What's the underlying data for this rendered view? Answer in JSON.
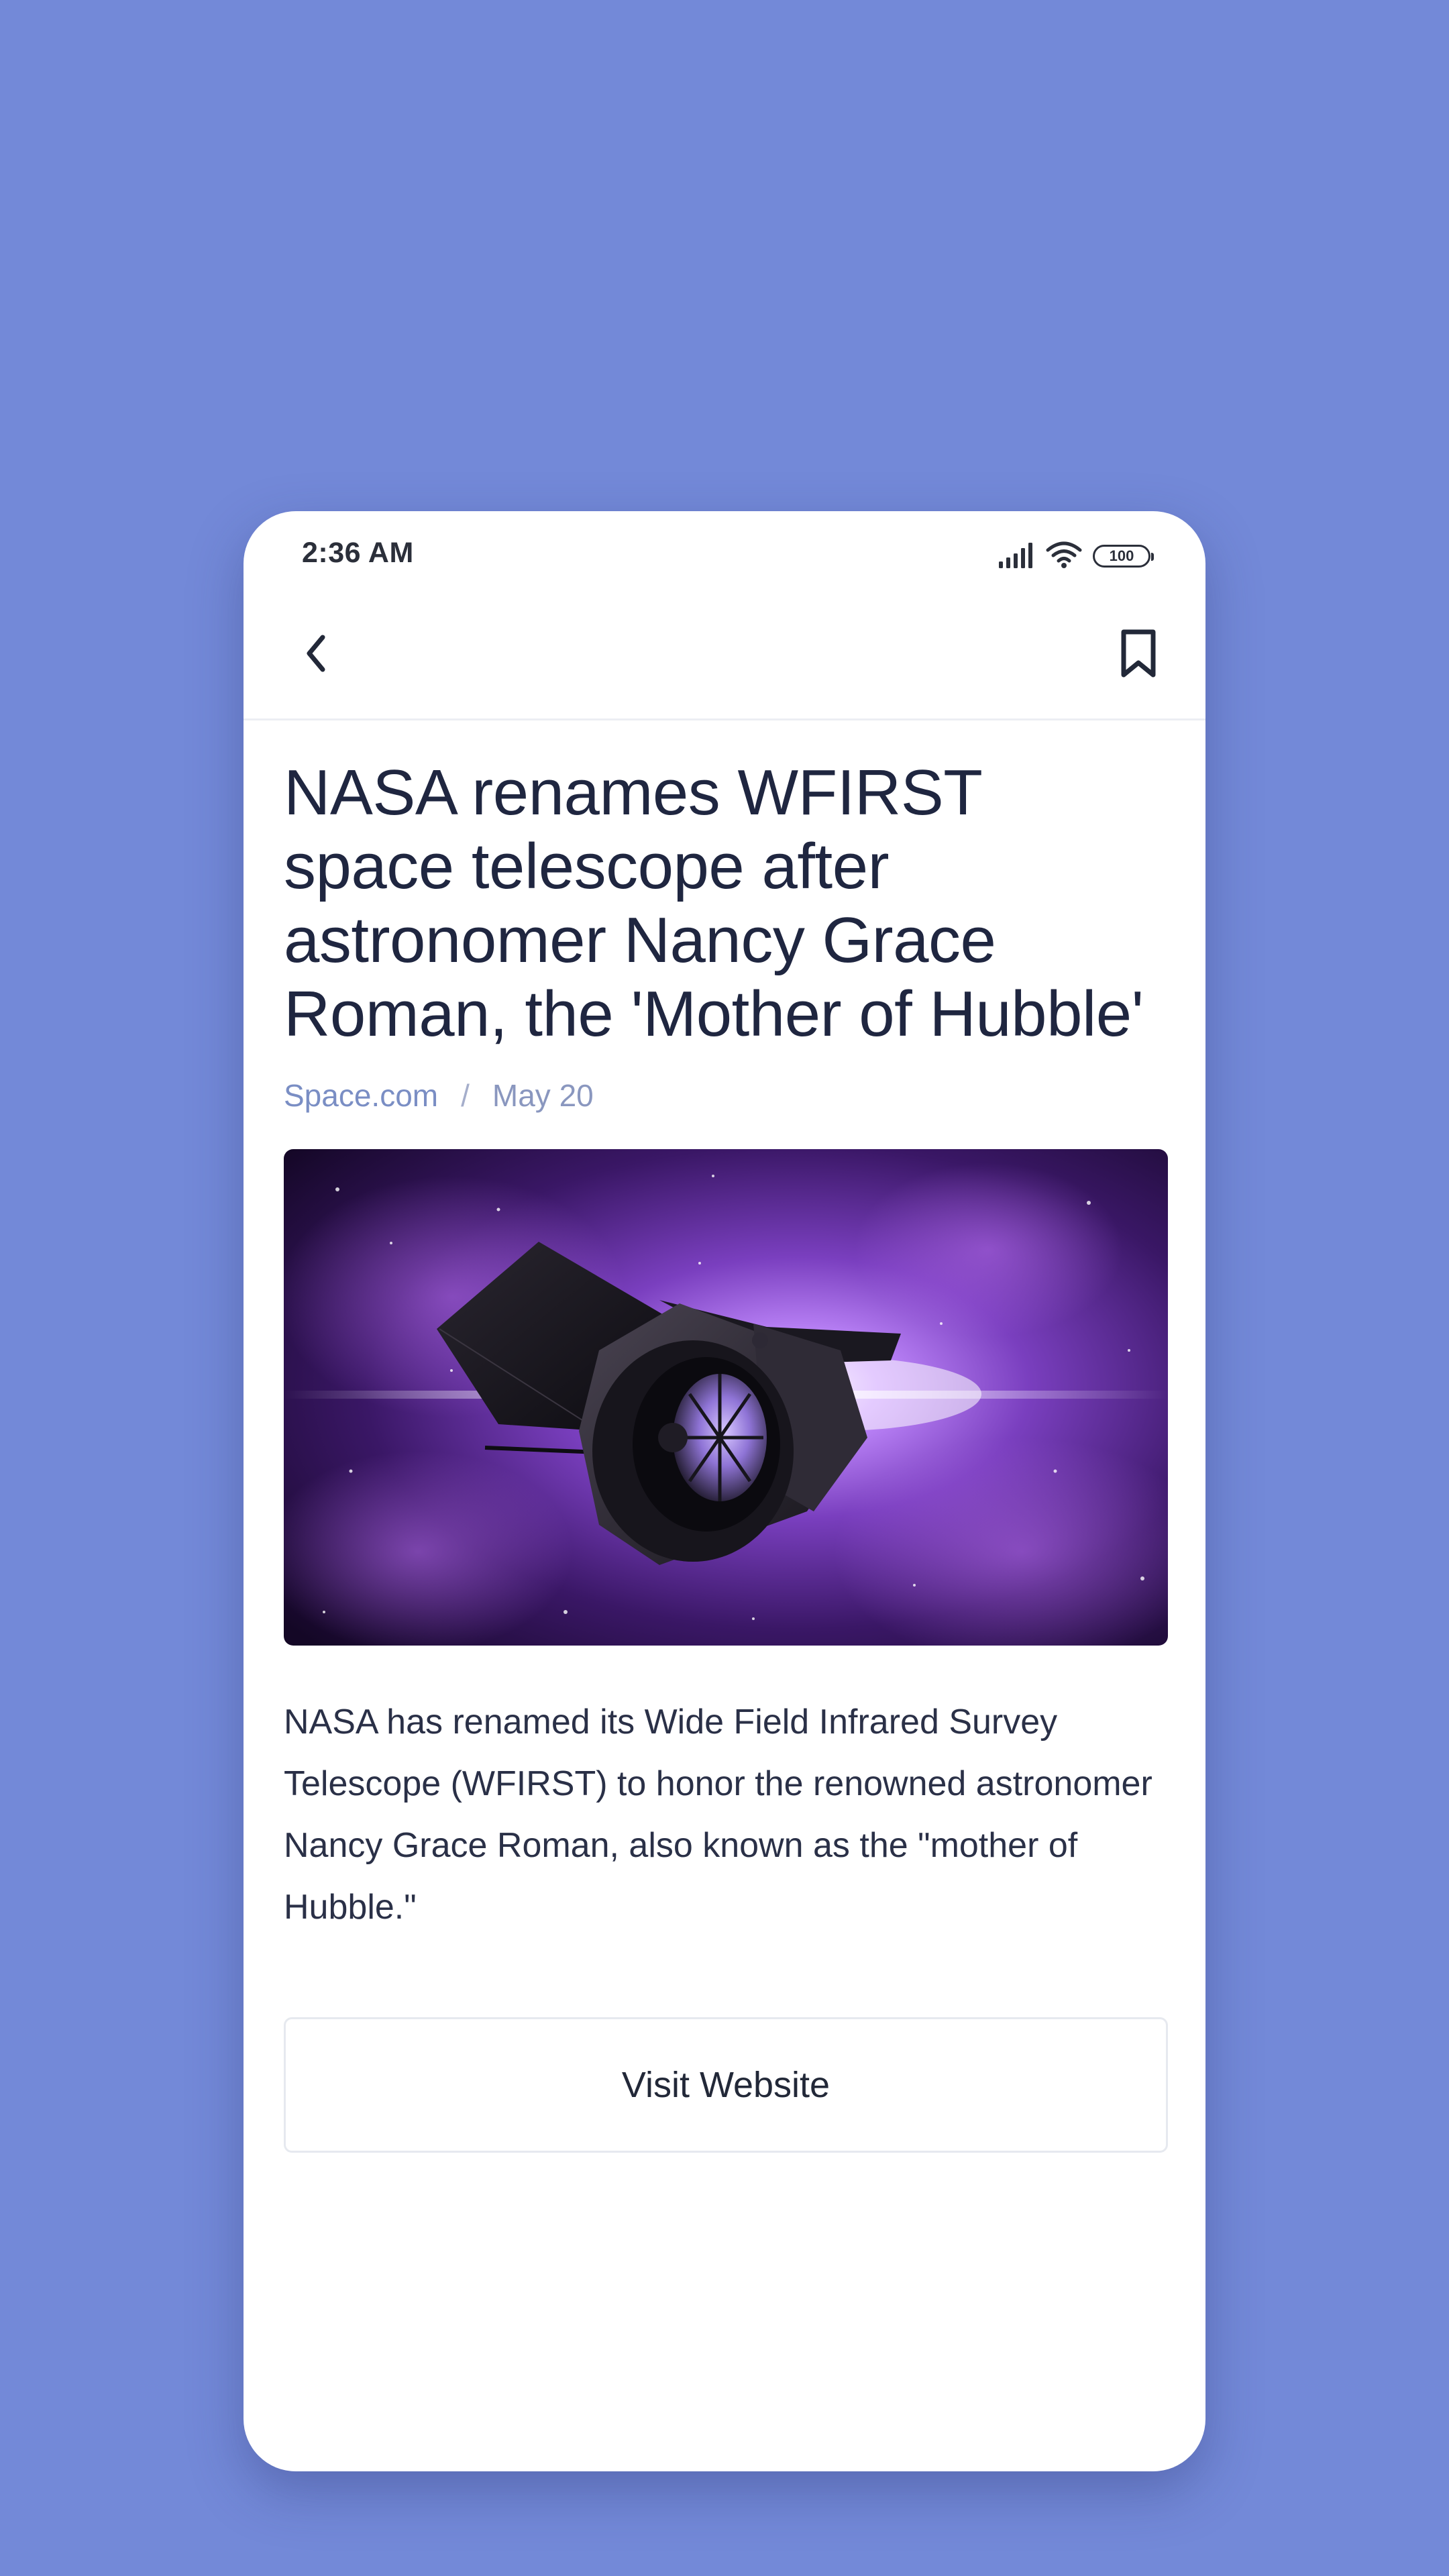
{
  "status_bar": {
    "time": "2:36 AM",
    "battery": "100",
    "icons": [
      "signal-icon",
      "wifi-icon",
      "battery-icon"
    ]
  },
  "toolbar": {
    "back_icon": "chevron-left-icon",
    "bookmark_icon": "bookmark-icon"
  },
  "article": {
    "title": "NASA renames WFIRST space telescope after astronomer Nancy Grace Roman, the 'Mother of Hubble'",
    "source": "Space.com",
    "separator": "/",
    "date": "May 20",
    "summary": "NASA has renamed its Wide Field Infrared Survey Telescope (WFIRST) to honor the renowned astronomer Nancy Grace Roman, also known as the \"mother of Hubble.\"",
    "visit_label": "Visit Website"
  },
  "colors": {
    "background": "#7389d8",
    "card": "#ffffff",
    "title_text": "#1f2640",
    "meta_text": "#8a97bf",
    "image_purple": "#8b4fd6"
  }
}
